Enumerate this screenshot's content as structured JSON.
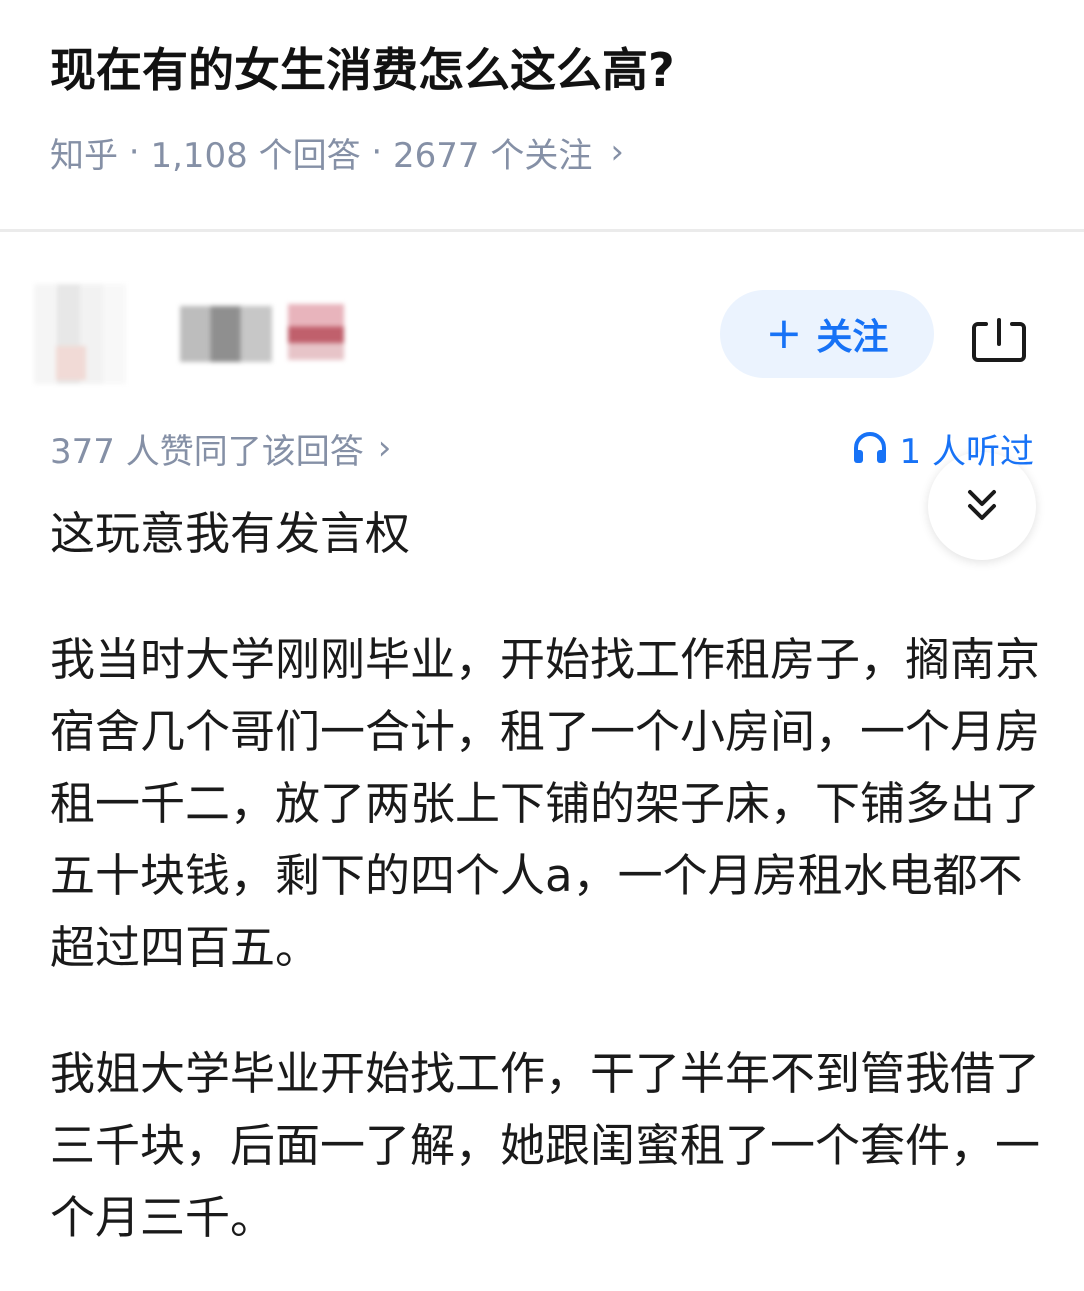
{
  "question": {
    "title": "现在有的女生消费怎么这么高?",
    "source": "知乎",
    "separator": " · ",
    "answers_count": "1,108 个回答",
    "followers_count": "2677 个关注",
    "chevron": "›"
  },
  "author": {
    "follow_label": "关注",
    "follow_plus": "+"
  },
  "answer": {
    "votes_text": "377 人赞同了该回答",
    "votes_chevron": "›",
    "listened_text": "1 人听过",
    "paragraphs": [
      "这玩意我有发言权",
      "我当时大学刚刚毕业，开始找工作租房子，搁南京宿舍几个哥们一合计，租了一个小房间，一个月房租一千二，放了两张上下铺的架子床，下铺多出了五十块钱，剩下的四个人a，一个月房租水电都不超过四百五。",
      "我姐大学毕业开始找工作，干了半年不到管我借了三千块，后面一了解，她跟闺蜜租了一个套件，一个月三千。"
    ]
  },
  "colors": {
    "accent": "#1772f6",
    "accent_bg": "#ebf3fe",
    "meta": "#8590a6",
    "text": "#1a1a1a"
  },
  "icons": {
    "share": "share-icon",
    "collapse": "double-chevron-down-icon",
    "headphones": "headphones-icon"
  }
}
